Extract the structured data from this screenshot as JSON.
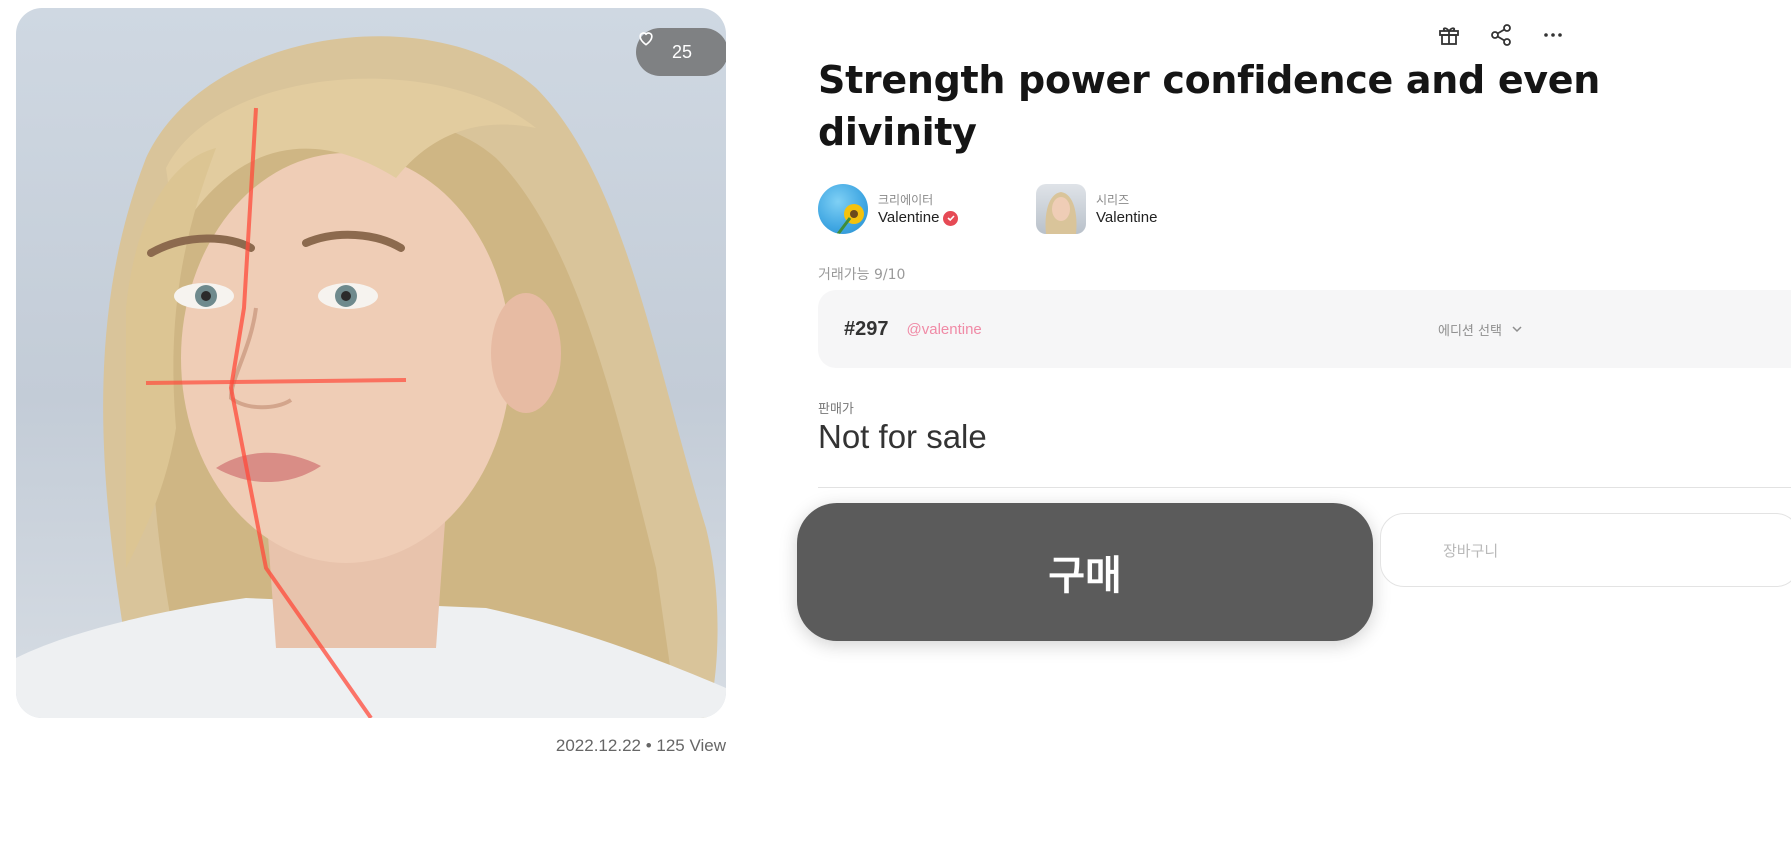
{
  "artwork": {
    "likes": "25",
    "date_views": "2022.12.22 • 125 View"
  },
  "header_actions": [
    "gift-icon",
    "share-icon",
    "more-icon"
  ],
  "title": "Strength power  confidence and even divinity",
  "creator": {
    "label": "크리에이터",
    "name": "Valentine",
    "verified": true
  },
  "series": {
    "label": "시리즈",
    "name": "Valentine"
  },
  "tradeable": "거래가능 9/10",
  "edition": {
    "number": "#297",
    "handle": "@valentine",
    "select_label": "에디션 선택"
  },
  "price": {
    "label": "판매가",
    "value": "Not for sale"
  },
  "buttons": {
    "buy": "구매",
    "cart": "장바구니"
  },
  "colors": {
    "buy_button": "#5b5b5b",
    "handle": "#f08aa6",
    "verified": "#e64a55",
    "edition_bg": "#f6f6f7"
  }
}
